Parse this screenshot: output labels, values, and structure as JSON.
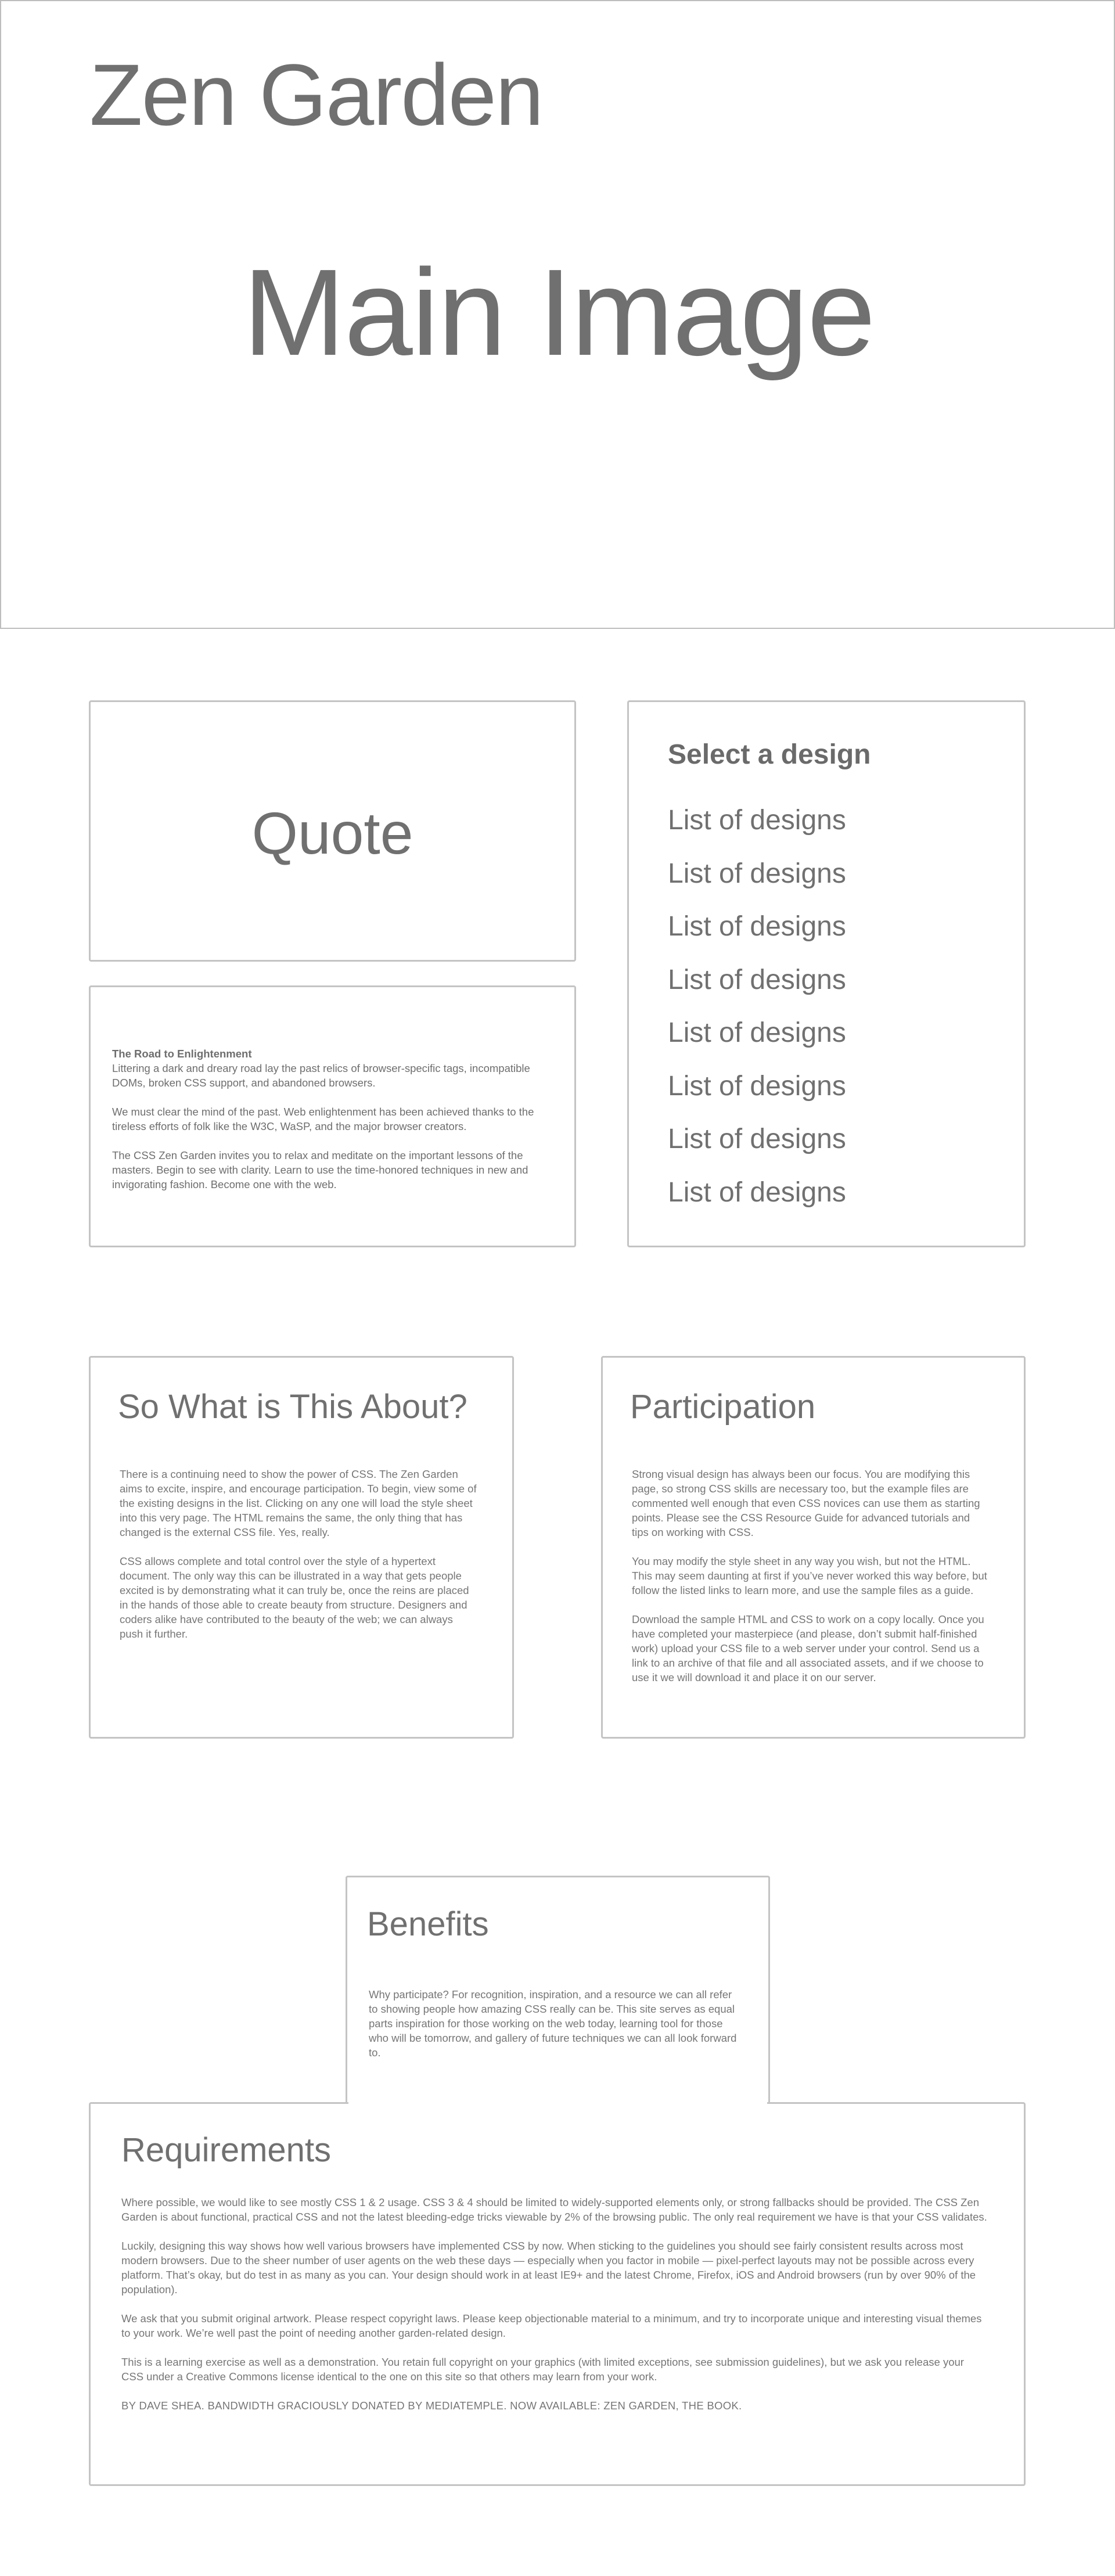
{
  "header": {
    "site_title": "Zen Garden",
    "main_image_label": "Main Image"
  },
  "quote": {
    "label": "Quote"
  },
  "intro": {
    "title": "The Road to Enlightenment",
    "lead": "Littering a dark and dreary road lay the past relics of browser-specific tags, incompatible DOMs, broken CSS support, and abandoned browsers.",
    "p2": "We must clear the mind of the past. Web enlightenment has been achieved thanks to the tireless efforts of folk like the W3C, WaSP, and the major browser creators.",
    "p3": "The CSS Zen Garden invites you to relax and meditate on the important lessons of the masters. Begin to see with clarity. Learn to use the time-honored techniques in new and invigorating fashion. Become one with the web."
  },
  "designs": {
    "heading": "Select a design",
    "items": [
      "List of designs",
      "List of designs",
      "List of designs",
      "List of designs",
      "List of designs",
      "List of designs",
      "List of designs",
      "List of designs"
    ]
  },
  "about": {
    "title": "So What is This About?",
    "p1": "There is a continuing need to show the power of CSS. The Zen Garden aims to excite, inspire, and encourage participation. To begin, view some of the existing designs in the list. Clicking on any one will load the style sheet into this very page. The HTML remains the same, the only thing that has changed is the external CSS file. Yes, really.",
    "p2": "CSS allows complete and total control over the style of a hypertext document. The only way this can be illustrated in a way that gets people excited is by demonstrating what it can truly be, once the reins are placed in the hands of those able to create beauty from structure. Designers and coders alike have contributed to the beauty of the web; we can always push it further."
  },
  "participation": {
    "title": "Participation",
    "p1": "Strong visual design has always been our focus. You are modifying this page, so strong CSS skills are necessary too, but the example files are commented well enough that even CSS novices can use them as starting points. Please see the CSS Resource Guide for advanced tutorials and tips on working with CSS.",
    "p2": "You may modify the style sheet in any way you wish, but not the HTML. This may seem daunting at first if you’ve never worked this way before, but follow the listed links to learn more, and use the sample files as a guide.",
    "p3": "Download the sample HTML and CSS to work on a copy locally. Once you have completed your masterpiece (and please, don’t submit half-finished work) upload your CSS file to a web server under your control. Send us a link to an archive of that file and all associated assets, and if we choose to use it we will download it and place it on our server."
  },
  "benefits": {
    "title": "Benefits",
    "p1": "Why participate? For recognition, inspiration, and a resource we can all refer to showing people how amazing CSS really can be. This site serves as equal parts inspiration for those working on the web today, learning tool for those who will be tomorrow, and gallery of future techniques we can all look forward to."
  },
  "requirements": {
    "title": "Requirements",
    "p1": "Where possible, we would like to see mostly CSS 1 & 2 usage. CSS 3 & 4 should be limited to widely-supported elements only, or strong fallbacks should be provided. The CSS Zen Garden is about functional, practical CSS and not the latest bleeding-edge tricks viewable by 2% of the browsing public. The only real requirement we have is that your CSS validates.",
    "p2": "Luckily, designing this way shows how well various browsers have implemented CSS by now. When sticking to the guidelines you should see fairly consistent results across most modern browsers. Due to the sheer number of user agents on the web these days — especially when you factor in mobile — pixel-perfect layouts may not be possible across every platform. That’s okay, but do test in as many as you can. Your design should work in at least IE9+ and the latest Chrome, Firefox, iOS and Android browsers (run by over 90% of the population).",
    "p3": "We ask that you submit original artwork. Please respect copyright laws. Please keep objectionable material to a minimum, and try to incorporate unique and interesting visual themes to your work. We’re well past the point of needing another garden-related design.",
    "p4": "This is a learning exercise as well as a demonstration. You retain full copyright on your graphics (with limited exceptions, see submission guidelines), but we ask you release your CSS under a Creative Commons license identical to the one on this site so that others may learn from your work.",
    "footer": "BY DAVE SHEA. BANDWIDTH GRACIOUSLY DONATED BY MEDIATEMPLE. NOW AVAILABLE: ZEN GARDEN, THE BOOK."
  }
}
